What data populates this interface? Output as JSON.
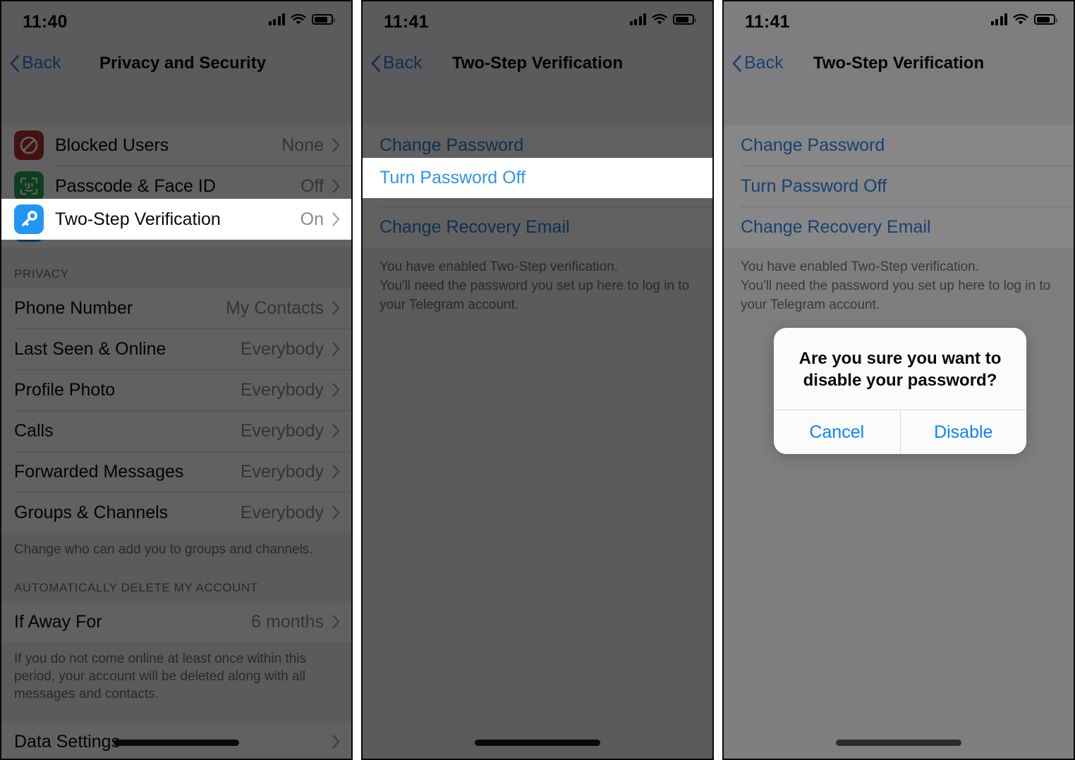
{
  "meta": {
    "app": "Telegram",
    "platform": "iOS",
    "accent_blue": "#2f7cd6",
    "alert_blue": "#0a84ff",
    "dim_color": "rgba(0,0,0,0.62)"
  },
  "panels": [
    {
      "id": "panel-1",
      "status_bar": {
        "time": "11:40",
        "cellular_icon": "signal-bars-icon",
        "wifi_icon": "wifi-icon",
        "battery_icon": "battery-icon"
      },
      "nav": {
        "back_label": "Back",
        "back_icon": "chevron-left-icon",
        "title": "Privacy and Security"
      },
      "security_rows": [
        {
          "icon": "blocked-users-icon",
          "icon_color": "#b2342f",
          "title": "Blocked Users",
          "value": "None",
          "chevron": "chevron-right-icon",
          "highlighted": false
        },
        {
          "icon": "face-id-icon",
          "icon_color": "#27a355",
          "title": "Passcode & Face ID",
          "value": "Off",
          "chevron": "chevron-right-icon",
          "highlighted": false
        },
        {
          "icon": "key-icon",
          "icon_color": "#2196f3",
          "title": "Two-Step Verification",
          "value": "On",
          "chevron": "chevron-right-icon",
          "highlighted": true
        }
      ],
      "privacy_header": "PRIVACY",
      "privacy_rows": [
        {
          "title": "Phone Number",
          "value": "My Contacts",
          "chevron": "chevron-right-icon"
        },
        {
          "title": "Last Seen & Online",
          "value": "Everybody",
          "chevron": "chevron-right-icon"
        },
        {
          "title": "Profile Photo",
          "value": "Everybody",
          "chevron": "chevron-right-icon"
        },
        {
          "title": "Calls",
          "value": "Everybody",
          "chevron": "chevron-right-icon"
        },
        {
          "title": "Forwarded Messages",
          "value": "Everybody",
          "chevron": "chevron-right-icon"
        },
        {
          "title": "Groups & Channels",
          "value": "Everybody",
          "chevron": "chevron-right-icon"
        }
      ],
      "privacy_footnote": "Change who can add you to groups and channels.",
      "delete_header": "AUTOMATICALLY DELETE MY ACCOUNT",
      "delete_row": {
        "title": "If Away For",
        "value": "6 months",
        "chevron": "chevron-right-icon"
      },
      "delete_footnote": "If you do not come online at least once within this period, your account will be deleted along with all messages and contacts.",
      "last_row": {
        "title": "Data Settings",
        "value": "",
        "chevron": "chevron-right-icon"
      }
    },
    {
      "id": "panel-2",
      "status_bar": {
        "time": "11:41",
        "cellular_icon": "signal-bars-icon",
        "wifi_icon": "wifi-icon",
        "battery_icon": "battery-icon"
      },
      "nav": {
        "back_label": "Back",
        "back_icon": "chevron-left-icon",
        "title": "Two-Step Verification"
      },
      "links": [
        {
          "label": "Change Password",
          "highlighted": false
        },
        {
          "label": "Turn Password Off",
          "highlighted": true
        },
        {
          "label": "Change Recovery Email",
          "highlighted": false
        }
      ],
      "info_lines": [
        "You have enabled Two-Step verification.",
        "You'll need the password you set up here to log in to",
        "your Telegram account."
      ]
    },
    {
      "id": "panel-3",
      "status_bar": {
        "time": "11:41",
        "cellular_icon": "signal-bars-icon",
        "wifi_icon": "wifi-icon",
        "battery_icon": "battery-icon"
      },
      "nav": {
        "back_label": "Back",
        "back_icon": "chevron-left-icon",
        "title": "Two-Step Verification"
      },
      "links": [
        {
          "label": "Change Password",
          "highlighted": false
        },
        {
          "label": "Turn Password Off",
          "highlighted": false
        },
        {
          "label": "Change Recovery Email",
          "highlighted": false
        }
      ],
      "info_lines": [
        "You have enabled Two-Step verification.",
        "You'll need the password you set up here to log in to",
        "your Telegram account."
      ],
      "alert": {
        "title": "Are you sure you want to disable your password?",
        "cancel_label": "Cancel",
        "confirm_label": "Disable"
      }
    }
  ]
}
